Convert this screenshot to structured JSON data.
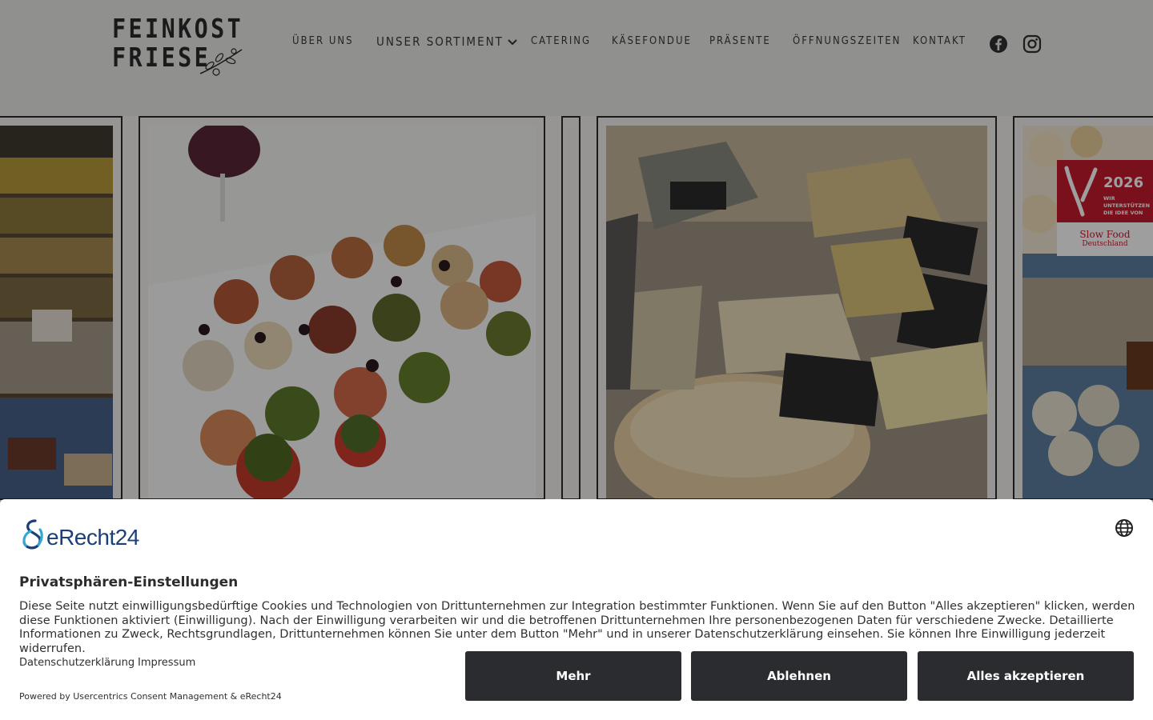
{
  "brand": {
    "line1": "FEINKOST",
    "line2": "FRIESE"
  },
  "nav": {
    "items": [
      {
        "label": "ÜBER UNS"
      },
      {
        "label": "UNSER SORTIMENT"
      },
      {
        "label": "CATERING"
      },
      {
        "label": "KÄSEFONDUE"
      },
      {
        "label": "PRÄSENTE"
      },
      {
        "label": "ÖFFNUNGSZEITEN"
      },
      {
        "label": "KONTAKT"
      }
    ],
    "social": [
      "facebook-icon",
      "instagram-icon"
    ]
  },
  "badge": {
    "year": "2026",
    "line1": "WIR",
    "line2": "UNTERSTÜTZEN",
    "line3": "DIE IDEE VON",
    "org": "Slow Food",
    "org_sub": "Deutschland"
  },
  "consent": {
    "provider": "eRecht24",
    "title": "Privatsphären-Einstellungen",
    "body": "Diese Seite nutzt einwilligungsbedürftige Cookies und Technologien von Drittunternehmen zur Integration bestimmter Funktionen. Wenn Sie auf den Button \"Alles akzeptieren\" klicken, werden diese Funktionen aktiviert (Einwilligung). Nach der Einwilligung verarbeiten wir und die betroffenen Drittunternehmen Ihre personenbezogenen Daten für verschiedene Zwecke. Detaillierte Informationen zu Zweck, Rechtsgrundlagen, Drittunternehmen können Sie unter dem Button \"Mehr\" und in unserer Datenschutzerklärung einsehen. Sie können Ihre Einwilligung jederzeit widerrufen.",
    "link_privacy": "Datenschutzerklärung",
    "link_imprint": "Impressum",
    "powered": "Powered by Usercentrics Consent Management & eRecht24",
    "btn_more": "Mehr",
    "btn_decline": "Ablehnen",
    "btn_accept": "Alles akzeptieren"
  },
  "colors": {
    "accent_dark": "#2b2c2f",
    "slowfood_red": "#c61b2c",
    "erecht_blue": "#1a3f7a"
  }
}
